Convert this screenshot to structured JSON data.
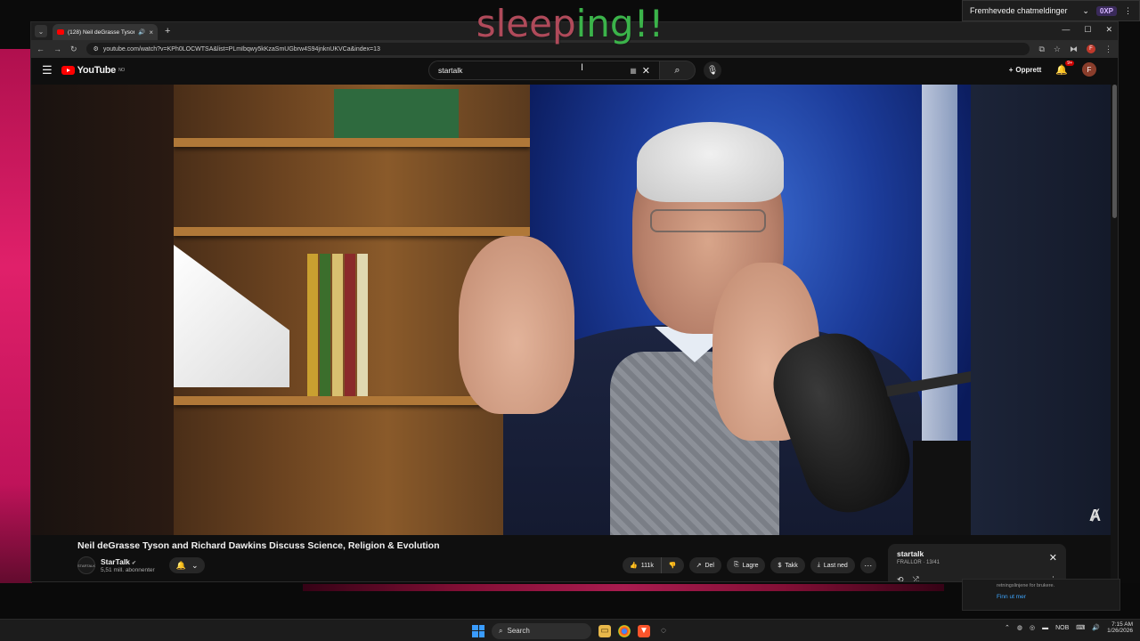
{
  "overlay_text": {
    "part1": "sleep",
    "part2": "ing!!"
  },
  "stream_bar": {
    "label": "Fremhevede chatmeldinger",
    "badge": "0XP"
  },
  "browser": {
    "tab_title": "(128) Neil deGrasse Tyson a",
    "url": "youtube.com/watch?v=KPh0LOCWTSA&list=PLmIbqwy5kKzaSmUGbrw4S94jnknUKVCa&index=13",
    "window_controls": {
      "minimize": "—",
      "maximize": "☐",
      "close": "✕"
    }
  },
  "youtube": {
    "logo_text": "YouTube",
    "logo_region": "NO",
    "search_value": "startalk",
    "create_label": "Opprett",
    "notification_count": "9+",
    "avatar_letter": "F"
  },
  "video": {
    "title": "Neil deGrasse Tyson and Richard Dawkins Discuss Science, Religion & Evolution",
    "channel_name": "StarTalk",
    "subscribers": "5,51 mill. abonnenter",
    "channel_avatar_text": "STARTALK",
    "corner_logo": "Ⱥ",
    "likes": "111k",
    "share_label": "Del",
    "save_label": "Lagre",
    "thanks_label": "Takk",
    "download_label": "Last ned"
  },
  "playlist": {
    "title": "startalk",
    "subtitle": "FRALLOR · 13/41"
  },
  "popup": {
    "text": "retningslinjene for brukere.",
    "link": "Finn ut mer"
  },
  "taskbar": {
    "search_label": "Search",
    "language": "NOB",
    "time": "7:15 AM",
    "date": "1/26/2026"
  }
}
